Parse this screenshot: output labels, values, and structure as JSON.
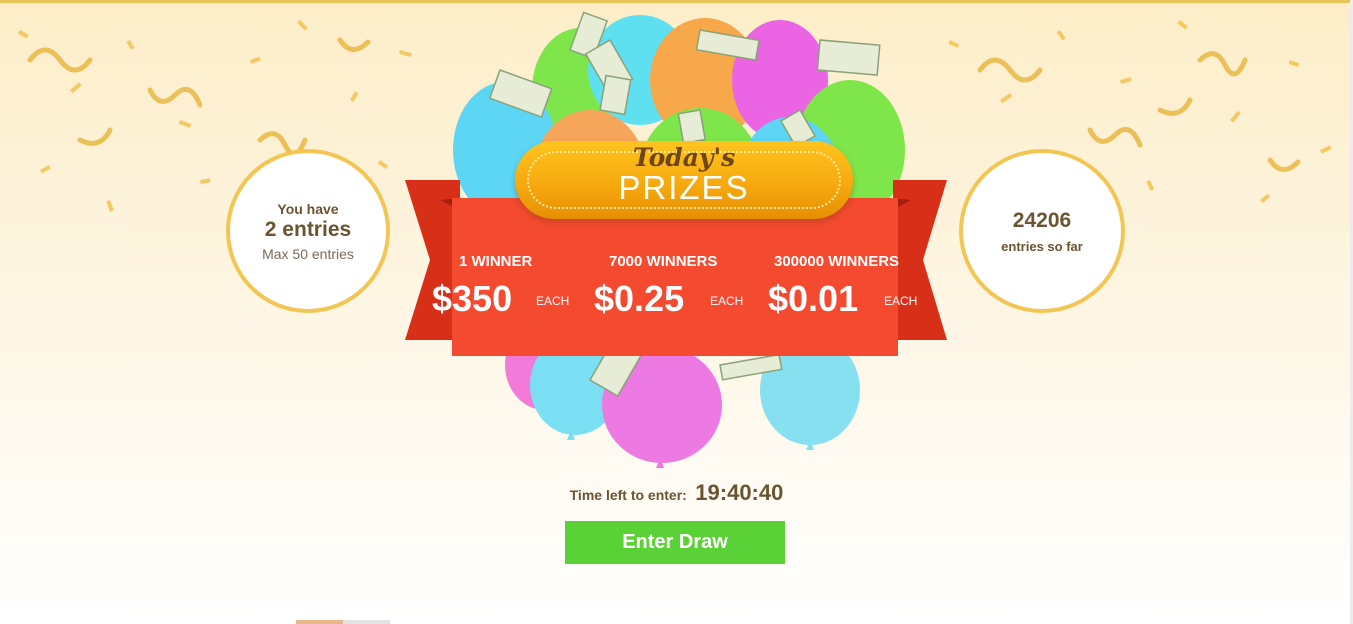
{
  "entries_card": {
    "line1": "You have",
    "count": "2 entries",
    "max": "Max 50 entries"
  },
  "total_card": {
    "count": "24206",
    "label": "entries so far"
  },
  "prizes_badge": {
    "script": "Today's",
    "title": "PRIZES"
  },
  "prizes": [
    {
      "winners": "1 WINNER",
      "amount": "$350",
      "each": "EACH"
    },
    {
      "winners": "7000 WINNERS",
      "amount": "$0.25",
      "each": "EACH"
    },
    {
      "winners": "300000 WINNERS",
      "amount": "$0.01",
      "each": "EACH"
    }
  ],
  "timer": {
    "label": "Time left to enter:",
    "value": "19:40:40"
  },
  "enter_button": {
    "label": "Enter Draw"
  },
  "colors": {
    "accent_green": "#5ad136",
    "banner_red": "#f34a30",
    "badge_gold": "#f6a70d",
    "circle_border": "#f3c653",
    "text_brown": "#6b5432"
  }
}
